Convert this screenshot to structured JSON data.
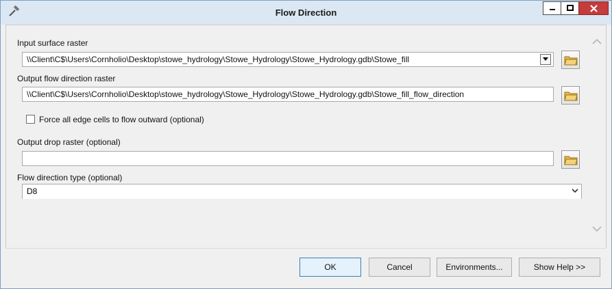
{
  "window": {
    "title": "Flow Direction"
  },
  "titlebar_icons": {
    "app": "hammer-icon",
    "minimize": "minimize-icon",
    "maximize": "maximize-icon",
    "close": "close-icon"
  },
  "form": {
    "input_surface_raster": {
      "label": "Input surface raster",
      "value": "\\\\Client\\C$\\Users\\Cornholio\\Desktop\\stowe_hydrology\\Stowe_Hydrology\\Stowe_Hydrology.gdb\\Stowe_fill"
    },
    "output_flow_direction_raster": {
      "label": "Output flow direction raster",
      "value": "\\\\Client\\C$\\Users\\Cornholio\\Desktop\\stowe_hydrology\\Stowe_Hydrology\\Stowe_Hydrology.gdb\\Stowe_fill_flow_direction"
    },
    "force_edge": {
      "label": "Force all edge cells to flow outward (optional)",
      "checked": false
    },
    "output_drop_raster": {
      "label": "Output drop raster (optional)",
      "value": ""
    },
    "flow_direction_type": {
      "label": "Flow direction type (optional)",
      "value": "D8"
    }
  },
  "buttons": {
    "ok": "OK",
    "cancel": "Cancel",
    "environments": "Environments...",
    "show_help": "Show Help >>"
  },
  "colors": {
    "titlebar": "#dbe7f3",
    "close": "#c43c3c",
    "folder": "#e8b84a"
  }
}
